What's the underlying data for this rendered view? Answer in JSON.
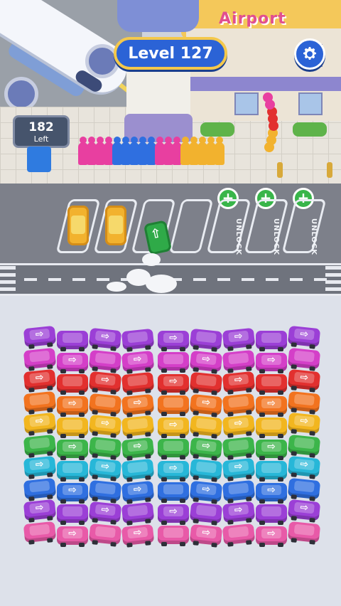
{
  "hud": {
    "level_label": "Level 127",
    "left_count": "182",
    "left_label": "Left"
  },
  "airport_sign": "Airport",
  "parking": {
    "slots": [
      {
        "state": "occupied",
        "car_color": "#f2b22e"
      },
      {
        "state": "occupied",
        "car_color": "#f2b22e"
      },
      {
        "state": "empty"
      },
      {
        "state": "empty"
      },
      {
        "state": "locked",
        "label": "UNLOCK",
        "button": "+"
      },
      {
        "state": "locked",
        "label": "UNLOCK",
        "button": "+"
      },
      {
        "state": "locked",
        "label": "UNLOCK",
        "button": "+"
      }
    ],
    "moving_car_color": "#2faa48"
  },
  "queue_colors": [
    "#e83fa0",
    "#e83fa0",
    "#e83fa0",
    "#e83fa0",
    "#2f6fe0",
    "#2f6fe0",
    "#2f6fe0",
    "#2f6fe0",
    "#2f6fe0",
    "#e83fa0",
    "#e83fa0",
    "#e83fa0",
    "#f2b22e",
    "#f2b22e",
    "#f2b22e",
    "#f2b22e",
    "#f2b22e"
  ],
  "car_grid": {
    "columns": 9,
    "rows": [
      {
        "color": "#9b3fd6"
      },
      {
        "color": "#d43fc8"
      },
      {
        "color": "#e2302f"
      },
      {
        "color": "#f2731f"
      },
      {
        "color": "#f2b61f"
      },
      {
        "color": "#3cb54a"
      },
      {
        "color": "#27b7d8"
      },
      {
        "color": "#2f6fe0"
      },
      {
        "color": "#9b3fd6"
      },
      {
        "color": "#e85aa8"
      }
    ]
  },
  "icons": {
    "settings": "gear-icon",
    "add_slot": "plus-icon",
    "car_direction": "arrow-right-icon"
  }
}
